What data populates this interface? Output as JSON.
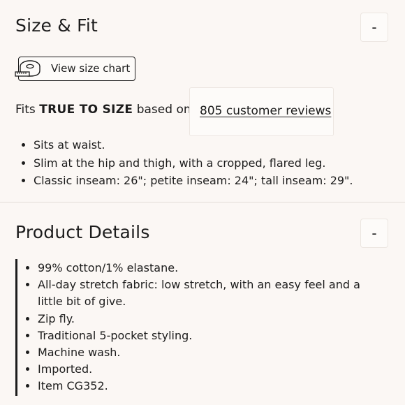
{
  "size_fit": {
    "title": "Size & Fit",
    "toggle_label": "-",
    "size_chart_label": "View size chart",
    "fits_prefix": "Fits",
    "fits_strong": "TRUE TO SIZE",
    "fits_suffix": "based on",
    "reviews_link": "805 customer reviews",
    "bullets": [
      "Sits at waist.",
      "Slim at the hip and thigh, with a cropped, flared leg.",
      "Classic inseam: 26\"; petite inseam: 24\"; tall inseam: 29\"."
    ]
  },
  "product_details": {
    "title": "Product Details",
    "toggle_label": "-",
    "bullets": [
      "99% cotton/1% elastane.",
      "All-day stretch fabric: low stretch, with an easy feel and a little bit of give.",
      "Zip fly.",
      "Traditional 5-pocket styling.",
      "Machine wash.",
      "Imported.",
      "Item CG352."
    ]
  },
  "icons": {
    "size_chart": "measuring-tape-icon"
  }
}
